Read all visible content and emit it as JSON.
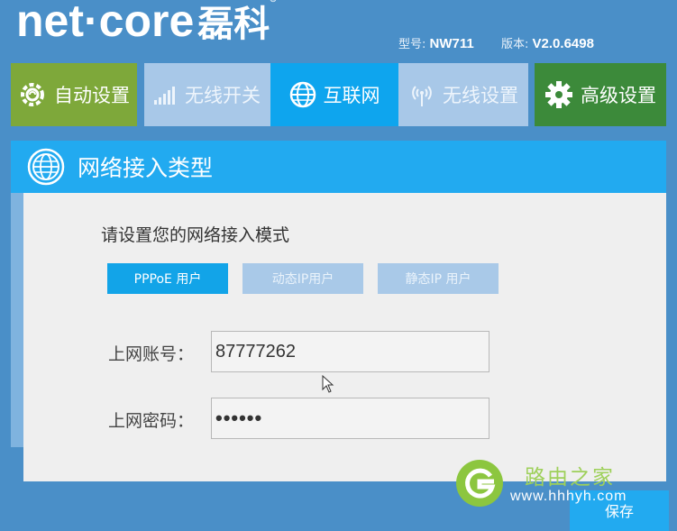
{
  "header": {
    "logo_text": "net·core",
    "logo_cn": "磊科",
    "logo_reg": "®",
    "model_label": "型号:",
    "model_value": "NW711",
    "version_label": "版本:",
    "version_value": "V2.0.6498"
  },
  "nav": [
    {
      "label": "自动设置",
      "icon": "gear-refresh-icon"
    },
    {
      "label": "无线开关",
      "icon": "signal-bars-icon"
    },
    {
      "label": "互联网",
      "icon": "globe-icon"
    },
    {
      "label": "无线设置",
      "icon": "wifi-antenna-icon"
    },
    {
      "label": "高级设置",
      "icon": "gear-icon"
    }
  ],
  "panel": {
    "title": "网络接入类型",
    "prompt": "请设置您的网络接入模式",
    "types": [
      "PPPoE 用户",
      "动态IP用户",
      "静态IP 用户"
    ],
    "selected_type": "PPPoE 用户",
    "account_label": "上网账号：",
    "account_value": "87777262",
    "password_label": "上网密码：",
    "password_value": "••••••",
    "save_label": "保存"
  },
  "watermark": {
    "text": "路由之家",
    "url": "www.hhhyh.com"
  },
  "colors": {
    "background": "#4a8fc8",
    "accent_blue": "#22aaf0",
    "auto_green": "#7ea83a",
    "advanced_green": "#3c8a3a",
    "inactive": "#a8c8e8"
  }
}
